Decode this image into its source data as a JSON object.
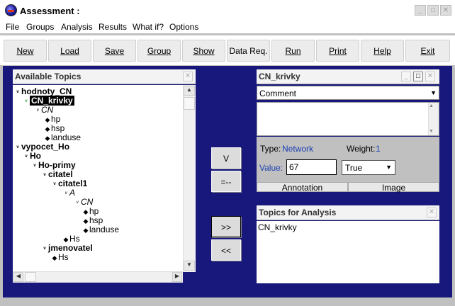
{
  "window": {
    "title": "Assessment :",
    "controls": [
      "_",
      "□",
      "✕"
    ]
  },
  "menu": [
    "File",
    "Groups",
    "Analysis",
    "Results",
    "What if?",
    "Options"
  ],
  "toolbar": [
    "New",
    "Load",
    "Save",
    "Group",
    "Show",
    "Data Req.",
    "Run",
    "Print",
    "Help",
    "Exit"
  ],
  "available_topics": {
    "title": "Available Topics",
    "tree": [
      {
        "label": "hodnoty_CN",
        "glyph": "chevron"
      },
      {
        "label": "CN_krivky",
        "glyph": "chevron-green"
      },
      {
        "label": "CN",
        "glyph": "chevron"
      },
      {
        "label": "hp",
        "glyph": "diamond"
      },
      {
        "label": "hsp",
        "glyph": "diamond"
      },
      {
        "label": "landuse",
        "glyph": "diamond"
      },
      {
        "label": "vypocet_Ho",
        "glyph": "chevron"
      },
      {
        "label": "Ho",
        "glyph": "chevron"
      },
      {
        "label": "Ho-primy",
        "glyph": "chevron"
      },
      {
        "label": "citatel",
        "glyph": "chevron"
      },
      {
        "label": "citatel1",
        "glyph": "chevron"
      },
      {
        "label": "A",
        "glyph": "chevron"
      },
      {
        "label": "CN",
        "glyph": "chevron"
      },
      {
        "label": "hp",
        "glyph": "diamond"
      },
      {
        "label": "hsp",
        "glyph": "diamond"
      },
      {
        "label": "landuse",
        "glyph": "diamond"
      },
      {
        "label": "Hs",
        "glyph": "diamond"
      },
      {
        "label": "jmenovatel",
        "glyph": "chevron"
      },
      {
        "label": "Hs",
        "glyph": "diamond"
      }
    ]
  },
  "operators": [
    "V",
    "=--"
  ],
  "transfer": [
    ">>",
    "<<"
  ],
  "detail": {
    "title": "CN_krivky",
    "comment_select": "Comment",
    "type_label": "Type:",
    "type_value": "Network",
    "weight_label": "Weight:",
    "weight_value": "1",
    "value_label": "Value:",
    "value_input": "67",
    "bool_select": "True",
    "tabs": [
      "Annotation",
      "Image"
    ]
  },
  "topics_for_analysis": {
    "title": "Topics for Analysis",
    "items": [
      "CN_krivky"
    ]
  },
  "colors": {
    "frame": "#17177c",
    "field_label": "#1b3fb0",
    "selection": "#000000"
  }
}
